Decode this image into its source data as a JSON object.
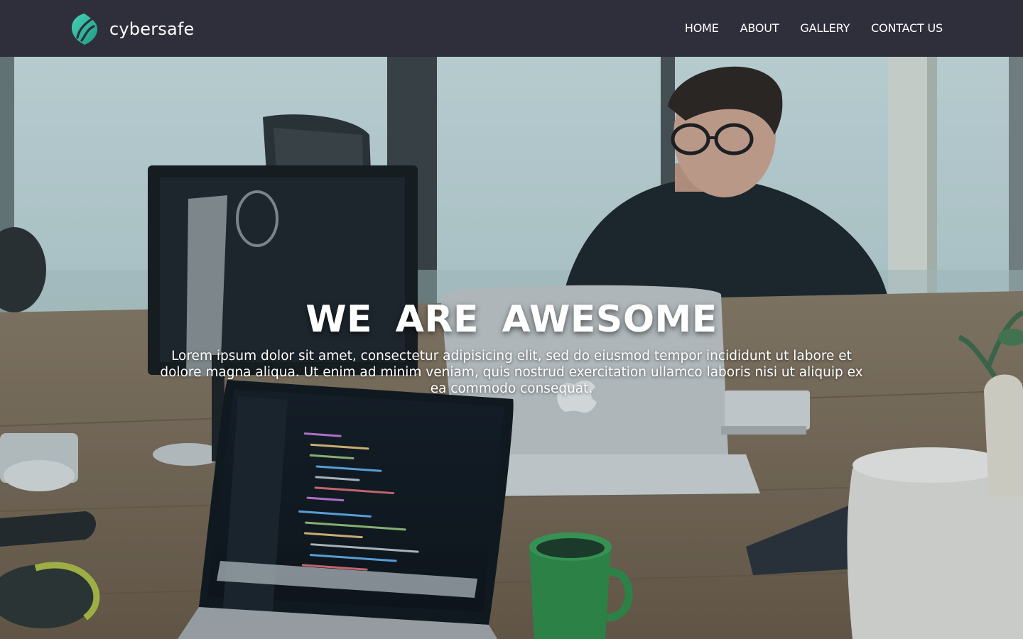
{
  "brand": {
    "name": "cybersafe",
    "logo_icon": "leaf-drop-logo-icon"
  },
  "nav": {
    "links": [
      "HOME",
      "ABOUT",
      "GALLERY",
      "CONTACT US"
    ]
  },
  "hero": {
    "title": "WE ARE AWESOME",
    "text": "Lorem ipsum dolor sit amet, consectetur adipisicing elit, sed do eiusmod tempor incididunt ut labore et dolore magna aliqua. Ut enim ad minim veniam, quis nostrud exercitation ullamco laboris nisi ut aliquip ex ea commodo consequat.",
    "background": "office-desk-scene"
  },
  "colors": {
    "navbar": "#2f2e3b",
    "text": "#ffffff",
    "logo_teal": "#3fc7b2",
    "logo_green": "#2fa37f"
  }
}
